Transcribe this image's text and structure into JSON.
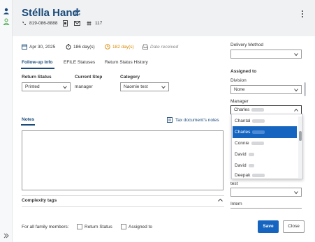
{
  "client": {
    "name": "Stélla Hand",
    "phone": "819-086-8888",
    "id_count": "117"
  },
  "info_row": {
    "date": "Apr 30, 2025",
    "days1": "186 day(s)",
    "days2": "182 day(s)",
    "date_received_placeholder": "Date received"
  },
  "tabs": [
    "Follow-up Info",
    "EFILE Statuses",
    "Return Status History"
  ],
  "fields": {
    "return_status_label": "Return Status",
    "return_status_value": "Printed",
    "current_step_label": "Current Step",
    "current_step_value": "manager",
    "category_label": "Category",
    "category_value": "Naomie test"
  },
  "notes": {
    "label": "Notes",
    "link": "Tax document's notes"
  },
  "complexity": {
    "label": "Complexity tags"
  },
  "footer": {
    "family_label": "For all family members:",
    "return_status": "Return Status",
    "assigned_to": "Assigned to"
  },
  "right_panel": {
    "delivery_method_label": "Delivery Method",
    "assigned_to_label": "Assigned to",
    "division_label": "Division",
    "division_value": "None",
    "manager_label": "Manager",
    "manager_value": "Charles",
    "test_label": "test",
    "intern_label": "Intern"
  },
  "manager_options": [
    "Chantal",
    "Charles",
    "Connie",
    "David",
    "David",
    "Deepak"
  ],
  "manager_selected_index": 1,
  "buttons": {
    "save": "Save",
    "close": "Close"
  },
  "colors": {
    "accent": "#1565c0",
    "title": "#1a4a7a",
    "warning": "#d98a00"
  }
}
